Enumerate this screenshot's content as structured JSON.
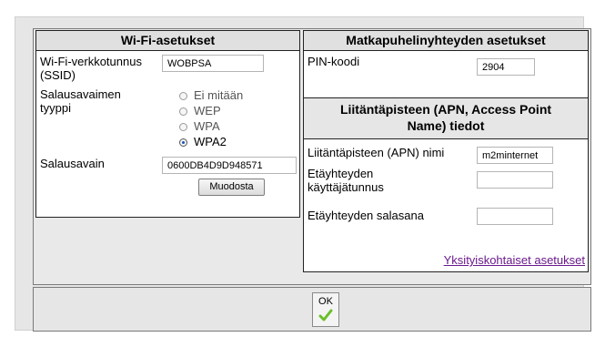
{
  "wifi": {
    "title": "Wi-Fi-asetukset",
    "ssid_label": "Wi-Fi-verkkotunnus (SSID)",
    "ssid_value": "WOBPSA",
    "keytype_label": "Salausavaimen tyyppi",
    "keytype_options": [
      "Ei mitään",
      "WEP",
      "WPA",
      "WPA2"
    ],
    "keytype_selected": "WPA2",
    "key_label": "Salausavain",
    "key_value": "0600DB4D9D948571",
    "generate_button": "Muodosta"
  },
  "mobile": {
    "title": "Matkapuhelinyhteyden asetukset",
    "pin_label": "PIN-koodi",
    "pin_value": "2904",
    "apn_title": "Liitäntäpisteen (APN, Access Point Name) tiedot",
    "apn_name_label": "Liitäntäpisteen (APN) nimi",
    "apn_name_value": "m2minternet",
    "remote_user_label": "Etäyhteyden käyttäjätunnus",
    "remote_user_value": "",
    "remote_password_label": "Etäyhteyden salasana",
    "remote_password_value": "",
    "custom_link": "Yksityiskohtaiset asetukset"
  },
  "footer": {
    "ok_label": "OK"
  },
  "colors": {
    "link": "#6a1a8c",
    "check": "#6bbf2a"
  }
}
